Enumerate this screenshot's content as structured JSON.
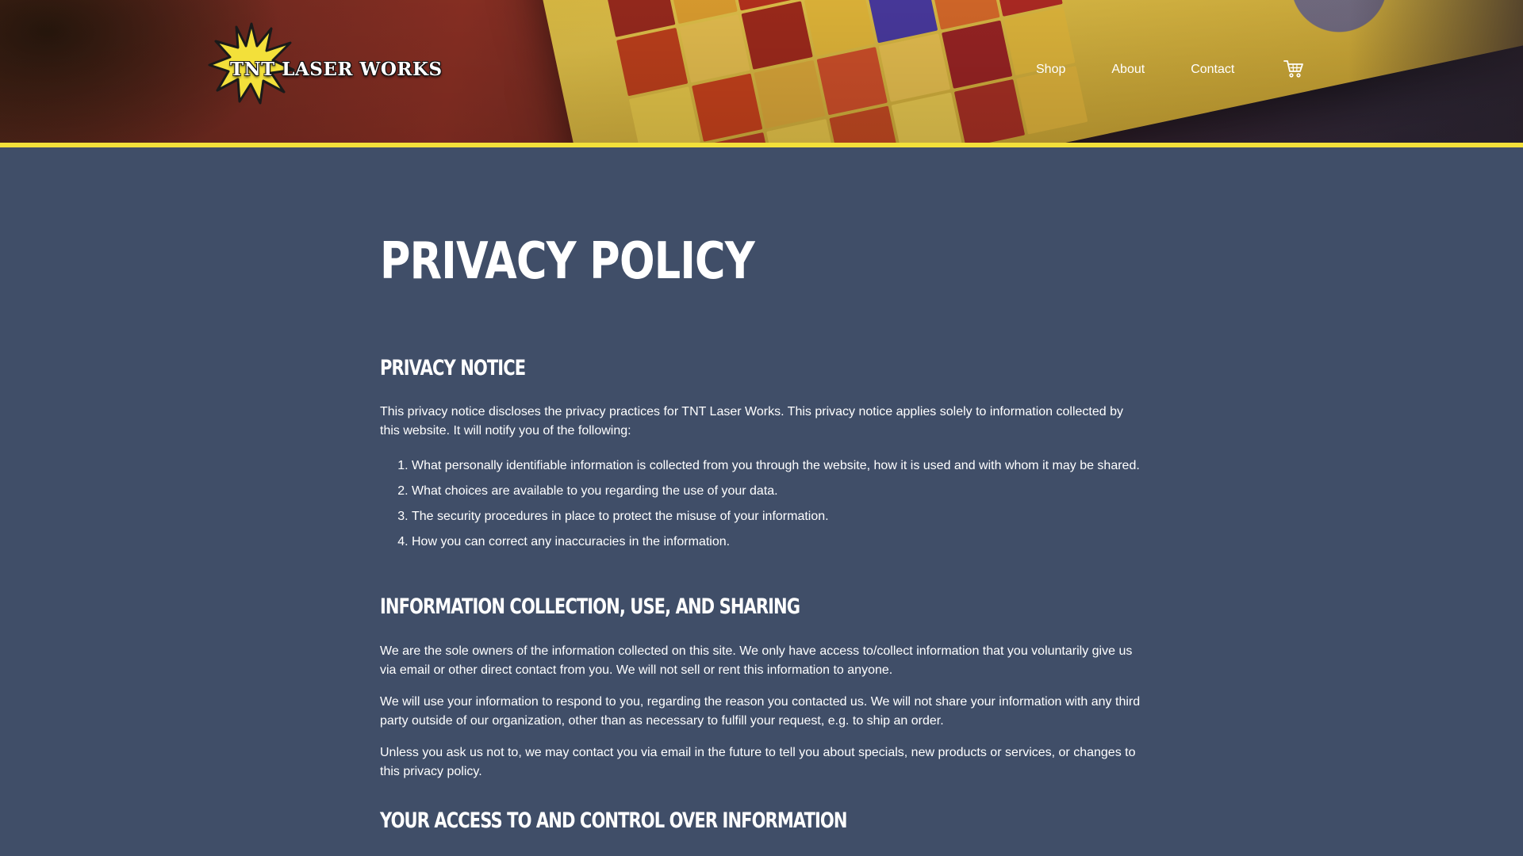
{
  "header": {
    "logo_text": "TNT LASER WORKS",
    "accent_color": "#f3e03a",
    "nav": {
      "shop": "Shop",
      "about": "About",
      "contact": "Contact"
    },
    "cart_icon": "shopping-cart-icon"
  },
  "page": {
    "background_color": "#404e68",
    "title": "PRIVACY POLICY",
    "sections": [
      {
        "heading": "PRIVACY NOTICE",
        "intro": "This privacy notice discloses the privacy practices for TNT Laser Works. This privacy notice applies solely to information collected by this website. It will notify you of the following:",
        "list": [
          "What personally identifiable information is collected from you through the website, how it is used and with whom it may be shared.",
          "What choices are available to you regarding the use of your data.",
          "The security procedures in place to protect the misuse of your information.",
          "How you can correct any inaccuracies in the information."
        ]
      },
      {
        "heading": "INFORMATION COLLECTION, USE, AND SHARING",
        "paragraphs": [
          "We are the sole owners of the information collected on this site. We only have access to/collect information that you voluntarily give us via email or other direct contact from you. We will not sell or rent this information to anyone.",
          "We will use your information to respond to you, regarding the reason you contacted us. We will not share your information with any third party outside of our organization, other than as necessary to fulfill your request, e.g. to ship an order.",
          "Unless you ask us not to, we may contact you via email in the future to tell you about specials, new products or services, or changes to this privacy policy."
        ]
      },
      {
        "heading": "YOUR ACCESS TO AND CONTROL OVER INFORMATION"
      }
    ]
  }
}
